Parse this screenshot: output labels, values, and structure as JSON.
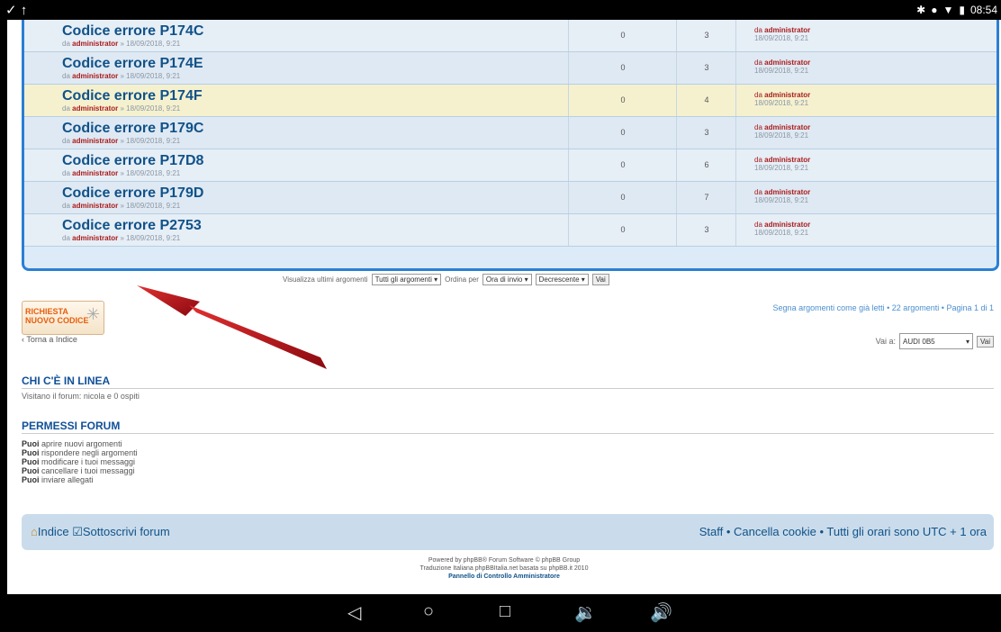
{
  "status": {
    "left_icons": "✓ ↑",
    "time": "08:54"
  },
  "topics": [
    {
      "title": "Codice errore P174C",
      "by": "da",
      "author": "administrator",
      "date": "» 18/09/2018, 9:21",
      "replies": "0",
      "views": "3",
      "last_by": "da",
      "last_author": "administrator",
      "last_date": "18/09/2018, 9:21"
    },
    {
      "title": "Codice errore P174E",
      "by": "da",
      "author": "administrator",
      "date": "» 18/09/2018, 9:21",
      "replies": "0",
      "views": "3",
      "last_by": "da",
      "last_author": "administrator",
      "last_date": "18/09/2018, 9:21"
    },
    {
      "title": "Codice errore P174F",
      "by": "da",
      "author": "administrator",
      "date": "» 18/09/2018, 9:21",
      "replies": "0",
      "views": "4",
      "last_by": "da",
      "last_author": "administrator",
      "last_date": "18/09/2018, 9:21"
    },
    {
      "title": "Codice errore P179C",
      "by": "da",
      "author": "administrator",
      "date": "» 18/09/2018, 9:21",
      "replies": "0",
      "views": "3",
      "last_by": "da",
      "last_author": "administrator",
      "last_date": "18/09/2018, 9:21"
    },
    {
      "title": "Codice errore P17D8",
      "by": "da",
      "author": "administrator",
      "date": "» 18/09/2018, 9:21",
      "replies": "0",
      "views": "6",
      "last_by": "da",
      "last_author": "administrator",
      "last_date": "18/09/2018, 9:21"
    },
    {
      "title": "Codice errore P179D",
      "by": "da",
      "author": "administrator",
      "date": "» 18/09/2018, 9:21",
      "replies": "0",
      "views": "7",
      "last_by": "da",
      "last_author": "administrator",
      "last_date": "18/09/2018, 9:21"
    },
    {
      "title": "Codice errore P2753",
      "by": "da",
      "author": "administrator",
      "date": "» 18/09/2018, 9:21",
      "replies": "0",
      "views": "3",
      "last_by": "da",
      "last_author": "administrator",
      "last_date": "18/09/2018, 9:21"
    }
  ],
  "sort": {
    "display_label": "Visualizza ultimi argomenti",
    "display_value": "Tutti gli argomenti",
    "order_label": "Ordina per",
    "order_value": "Ora di invio",
    "direction_value": "Decrescente",
    "go_label": "Vai"
  },
  "new_topic": {
    "line1": "RICHIESTA",
    "line2": "NUOVO CODICE"
  },
  "pagination_text": "Segna argomenti come già letti • 22 argomenti • Pagina 1 di 1",
  "back_link": "‹ Torna a Indice",
  "jump": {
    "label": "Vai a:",
    "value": "AUDI 0B5",
    "go_label": "Vai"
  },
  "online": {
    "heading": "CHI C'È IN LINEA",
    "text": "Visitano il forum: nicola e 0 ospiti"
  },
  "permissions": {
    "heading": "PERMESSI FORUM",
    "items": [
      {
        "bold": "Puoi",
        "rest": "aprire nuovi argomenti"
      },
      {
        "bold": "Puoi",
        "rest": "rispondere negli argomenti"
      },
      {
        "bold": "Puoi",
        "rest": "modificare i tuoi messaggi"
      },
      {
        "bold": "Puoi",
        "rest": "cancellare i tuoi messaggi"
      },
      {
        "bold": "Puoi",
        "rest": "inviare allegati"
      }
    ]
  },
  "navbar": {
    "index_label": "Indice",
    "subscribe_label": "Sottoscrivi forum",
    "staff_label": "Staff",
    "cookies_label": "Cancella cookie",
    "timezone_text": "Tutti gli orari sono UTC + 1 ora"
  },
  "footer": {
    "line1": "Powered by phpBB® Forum Software © phpBB Group",
    "line2": "Traduzione Italiana phpBBItalia.net basata su phpBB.it 2010",
    "acp": "Pannello di Controllo Amministratore"
  },
  "colors": {
    "accent": "#2a7fd4",
    "link": "#105289",
    "author": "#aa1b1b",
    "new_topic": "#e85d0b",
    "arrow": "#c0101a"
  }
}
